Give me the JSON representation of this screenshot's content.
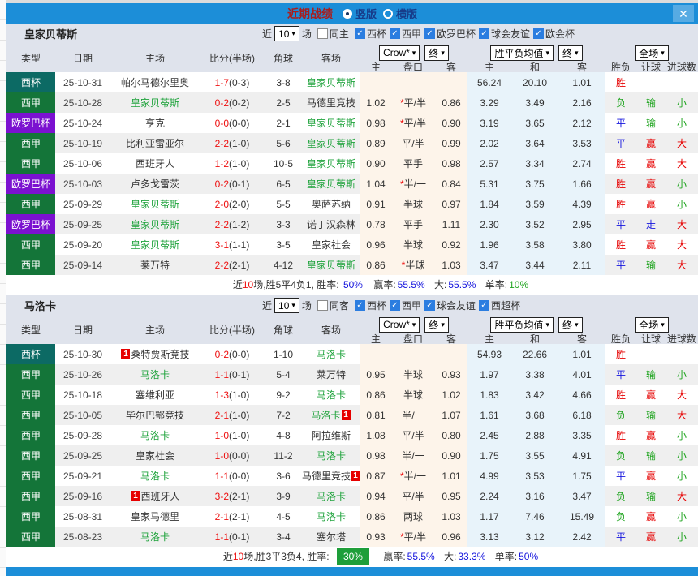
{
  "titlebar": {
    "title": "近期战绩",
    "vertical_label": "竖版",
    "horizontal_label": "横版",
    "close_icon": "✕"
  },
  "icons": {
    "check": "✓",
    "chevron": "▾"
  },
  "controls": {
    "near": "近",
    "count": "10",
    "games": "场",
    "crow": "Crow*",
    "final": "终",
    "avg": "胜平负均值",
    "full": "全场"
  },
  "columns": {
    "type": "类型",
    "date": "日期",
    "home": "主场",
    "score": "比分(半场)",
    "corner": "角球",
    "away": "客场",
    "odd_home": "主",
    "handicap": "盘口",
    "odd_away": "客",
    "avg_home": "主",
    "avg_draw": "和",
    "avg_away": "客",
    "result": "胜负",
    "handicap_result": "让球",
    "goals": "进球数"
  },
  "league_colors": {
    "西杯": "#0c6a64",
    "西甲": "#147539",
    "欧罗巴杯": "#7b11d0"
  },
  "result_colors": {
    "胜": "#e60000",
    "平": "#1414dd",
    "负": "#1fa41f",
    "赢": "#e60000",
    "输": "#1fa41f",
    "走": "#1414dd",
    "大": "#e60000",
    "小": "#1fa41f"
  },
  "colors": {
    "titlebar_blue": "#1c8ed8",
    "header_bg": "#dfe3ec",
    "crow_band": "#fdf4ea",
    "avg_band": "#e8f3fa",
    "win_badge_green": "#1e9e3a"
  },
  "sections": [
    {
      "team": "皇家贝蒂斯",
      "same_label": "同主",
      "leagues": [
        "西杯",
        "西甲",
        "欧罗巴杯",
        "球会友谊",
        "欧会杯"
      ],
      "rows": [
        {
          "league": "西杯",
          "date": "25-10-31",
          "home": "帕尔马德尔里奥",
          "home_green": false,
          "home_card": "",
          "ft": "1-7",
          "ht": "(0-3)",
          "corner": "3-8",
          "away": "皇家贝蒂斯",
          "away_green": true,
          "away_card": "",
          "o1": "",
          "hcap": "",
          "o2": "",
          "a1": "56.24",
          "a2": "20.10",
          "a3": "1.01",
          "res": "胜",
          "let": "",
          "goal": ""
        },
        {
          "league": "西甲",
          "date": "25-10-28",
          "home": "皇家贝蒂斯",
          "home_green": true,
          "home_card": "",
          "ft": "0-2",
          "ht": "(0-2)",
          "corner": "2-5",
          "away": "马德里竞技",
          "away_green": false,
          "away_card": "",
          "o1": "1.02",
          "hcap": "*平/半",
          "o2": "0.86",
          "a1": "3.29",
          "a2": "3.49",
          "a3": "2.16",
          "res": "负",
          "let": "输",
          "goal": "小"
        },
        {
          "league": "欧罗巴杯",
          "date": "25-10-24",
          "home": "亨克",
          "home_green": false,
          "home_card": "",
          "ft": "0-0",
          "ht": "(0-0)",
          "corner": "2-1",
          "away": "皇家贝蒂斯",
          "away_green": true,
          "away_card": "",
          "o1": "0.98",
          "hcap": "*平/半",
          "o2": "0.90",
          "a1": "3.19",
          "a2": "3.65",
          "a3": "2.12",
          "res": "平",
          "let": "输",
          "goal": "小"
        },
        {
          "league": "西甲",
          "date": "25-10-19",
          "home": "比利亚雷亚尔",
          "home_green": false,
          "home_card": "",
          "ft": "2-2",
          "ht": "(1-0)",
          "corner": "5-6",
          "away": "皇家贝蒂斯",
          "away_green": true,
          "away_card": "",
          "o1": "0.89",
          "hcap": "平/半",
          "o2": "0.99",
          "a1": "2.02",
          "a2": "3.64",
          "a3": "3.53",
          "res": "平",
          "let": "赢",
          "goal": "大"
        },
        {
          "league": "西甲",
          "date": "25-10-06",
          "home": "西班牙人",
          "home_green": false,
          "home_card": "",
          "ft": "1-2",
          "ht": "(1-0)",
          "corner": "10-5",
          "away": "皇家贝蒂斯",
          "away_green": true,
          "away_card": "",
          "o1": "0.90",
          "hcap": "平手",
          "o2": "0.98",
          "a1": "2.57",
          "a2": "3.34",
          "a3": "2.74",
          "res": "胜",
          "let": "赢",
          "goal": "大"
        },
        {
          "league": "欧罗巴杯",
          "date": "25-10-03",
          "home": "卢多戈雷茨",
          "home_green": false,
          "home_card": "",
          "ft": "0-2",
          "ht": "(0-1)",
          "corner": "6-5",
          "away": "皇家贝蒂斯",
          "away_green": true,
          "away_card": "",
          "o1": "1.04",
          "hcap": "*半/一",
          "o2": "0.84",
          "a1": "5.31",
          "a2": "3.75",
          "a3": "1.66",
          "res": "胜",
          "let": "赢",
          "goal": "小"
        },
        {
          "league": "西甲",
          "date": "25-09-29",
          "home": "皇家贝蒂斯",
          "home_green": true,
          "home_card": "",
          "ft": "2-0",
          "ht": "(2-0)",
          "corner": "5-5",
          "away": "奥萨苏纳",
          "away_green": false,
          "away_card": "",
          "o1": "0.91",
          "hcap": "半球",
          "o2": "0.97",
          "a1": "1.84",
          "a2": "3.59",
          "a3": "4.39",
          "res": "胜",
          "let": "赢",
          "goal": "小"
        },
        {
          "league": "欧罗巴杯",
          "date": "25-09-25",
          "home": "皇家贝蒂斯",
          "home_green": true,
          "home_card": "",
          "ft": "2-2",
          "ht": "(1-2)",
          "corner": "3-3",
          "away": "诺丁汉森林",
          "away_green": false,
          "away_card": "",
          "o1": "0.78",
          "hcap": "平手",
          "o2": "1.11",
          "a1": "2.30",
          "a2": "3.52",
          "a3": "2.95",
          "res": "平",
          "let": "走",
          "goal": "大"
        },
        {
          "league": "西甲",
          "date": "25-09-20",
          "home": "皇家贝蒂斯",
          "home_green": true,
          "home_card": "",
          "ft": "3-1",
          "ht": "(1-1)",
          "corner": "3-5",
          "away": "皇家社会",
          "away_green": false,
          "away_card": "",
          "o1": "0.96",
          "hcap": "半球",
          "o2": "0.92",
          "a1": "1.96",
          "a2": "3.58",
          "a3": "3.80",
          "res": "胜",
          "let": "赢",
          "goal": "大"
        },
        {
          "league": "西甲",
          "date": "25-09-14",
          "home": "莱万特",
          "home_green": false,
          "home_card": "",
          "ft": "2-2",
          "ht": "(2-1)",
          "corner": "4-12",
          "away": "皇家贝蒂斯",
          "away_green": true,
          "away_card": "",
          "o1": "0.86",
          "hcap": "*半球",
          "o2": "1.03",
          "a1": "3.47",
          "a2": "3.44",
          "a3": "2.11",
          "res": "平",
          "let": "输",
          "goal": "大"
        }
      ],
      "summary": {
        "near_label": "近",
        "count": "10",
        "stats": "场,胜5平4负1, 胜率:",
        "win_rate": "50%",
        "labels": [
          "赢率:",
          "大:",
          "单率:"
        ],
        "values": [
          "55.5%",
          "55.5%",
          "10%"
        ],
        "value_colors": [
          "blue",
          "blue",
          "green"
        ]
      }
    },
    {
      "team": "马洛卡",
      "same_label": "同客",
      "leagues": [
        "西杯",
        "西甲",
        "球会友谊",
        "西超杯"
      ],
      "rows": [
        {
          "league": "西杯",
          "date": "25-10-30",
          "home": "桑特贾斯竞技",
          "home_green": false,
          "home_card": "1",
          "ft": "0-2",
          "ht": "(0-0)",
          "corner": "1-10",
          "away": "马洛卡",
          "away_green": true,
          "away_card": "",
          "o1": "",
          "hcap": "",
          "o2": "",
          "a1": "54.93",
          "a2": "22.66",
          "a3": "1.01",
          "res": "胜",
          "let": "",
          "goal": ""
        },
        {
          "league": "西甲",
          "date": "25-10-26",
          "home": "马洛卡",
          "home_green": true,
          "home_card": "",
          "ft": "1-1",
          "ht": "(0-1)",
          "corner": "5-4",
          "away": "莱万特",
          "away_green": false,
          "away_card": "",
          "o1": "0.95",
          "hcap": "半球",
          "o2": "0.93",
          "a1": "1.97",
          "a2": "3.38",
          "a3": "4.01",
          "res": "平",
          "let": "输",
          "goal": "小"
        },
        {
          "league": "西甲",
          "date": "25-10-18",
          "home": "塞维利亚",
          "home_green": false,
          "home_card": "",
          "ft": "1-3",
          "ht": "(1-0)",
          "corner": "9-2",
          "away": "马洛卡",
          "away_green": true,
          "away_card": "",
          "o1": "0.86",
          "hcap": "半球",
          "o2": "1.02",
          "a1": "1.83",
          "a2": "3.42",
          "a3": "4.66",
          "res": "胜",
          "let": "赢",
          "goal": "大"
        },
        {
          "league": "西甲",
          "date": "25-10-05",
          "home": "毕尔巴鄂竞技",
          "home_green": false,
          "home_card": "",
          "ft": "2-1",
          "ht": "(1-0)",
          "corner": "7-2",
          "away": "马洛卡",
          "away_green": true,
          "away_card": "1",
          "o1": "0.81",
          "hcap": "半/一",
          "o2": "1.07",
          "a1": "1.61",
          "a2": "3.68",
          "a3": "6.18",
          "res": "负",
          "let": "输",
          "goal": "大"
        },
        {
          "league": "西甲",
          "date": "25-09-28",
          "home": "马洛卡",
          "home_green": true,
          "home_card": "",
          "ft": "1-0",
          "ht": "(1-0)",
          "corner": "4-8",
          "away": "阿拉维斯",
          "away_green": false,
          "away_card": "",
          "o1": "1.08",
          "hcap": "平/半",
          "o2": "0.80",
          "a1": "2.45",
          "a2": "2.88",
          "a3": "3.35",
          "res": "胜",
          "let": "赢",
          "goal": "小"
        },
        {
          "league": "西甲",
          "date": "25-09-25",
          "home": "皇家社会",
          "home_green": false,
          "home_card": "",
          "ft": "1-0",
          "ht": "(0-0)",
          "corner": "11-2",
          "away": "马洛卡",
          "away_green": true,
          "away_card": "",
          "o1": "0.98",
          "hcap": "半/一",
          "o2": "0.90",
          "a1": "1.75",
          "a2": "3.55",
          "a3": "4.91",
          "res": "负",
          "let": "输",
          "goal": "小"
        },
        {
          "league": "西甲",
          "date": "25-09-21",
          "home": "马洛卡",
          "home_green": true,
          "home_card": "",
          "ft": "1-1",
          "ht": "(0-0)",
          "corner": "3-6",
          "away": "马德里竞技",
          "away_green": false,
          "away_card": "1",
          "o1": "0.87",
          "hcap": "*半/一",
          "o2": "1.01",
          "a1": "4.99",
          "a2": "3.53",
          "a3": "1.75",
          "res": "平",
          "let": "赢",
          "goal": "小"
        },
        {
          "league": "西甲",
          "date": "25-09-16",
          "home": "西班牙人",
          "home_green": false,
          "home_card": "1",
          "ft": "3-2",
          "ht": "(2-1)",
          "corner": "3-9",
          "away": "马洛卡",
          "away_green": true,
          "away_card": "",
          "o1": "0.94",
          "hcap": "平/半",
          "o2": "0.95",
          "a1": "2.24",
          "a2": "3.16",
          "a3": "3.47",
          "res": "负",
          "let": "输",
          "goal": "大"
        },
        {
          "league": "西甲",
          "date": "25-08-31",
          "home": "皇家马德里",
          "home_green": false,
          "home_card": "",
          "ft": "2-1",
          "ht": "(2-1)",
          "corner": "4-5",
          "away": "马洛卡",
          "away_green": true,
          "away_card": "",
          "o1": "0.86",
          "hcap": "两球",
          "o2": "1.03",
          "a1": "1.17",
          "a2": "7.46",
          "a3": "15.49",
          "res": "负",
          "let": "赢",
          "goal": "小"
        },
        {
          "league": "西甲",
          "date": "25-08-23",
          "home": "马洛卡",
          "home_green": true,
          "home_card": "",
          "ft": "1-1",
          "ht": "(0-1)",
          "corner": "3-4",
          "away": "塞尔塔",
          "away_green": false,
          "away_card": "",
          "o1": "0.93",
          "hcap": "*平/半",
          "o2": "0.96",
          "a1": "3.13",
          "a2": "3.12",
          "a3": "2.42",
          "res": "平",
          "let": "赢",
          "goal": "小"
        }
      ],
      "summary": {
        "near_label": "近",
        "count": "10",
        "stats": "场,胜3平3负4, 胜率:",
        "win_rate": "30%",
        "labels": [
          "赢率:",
          "大:",
          "单率:"
        ],
        "values": [
          "55.5%",
          "33.3%",
          "50%"
        ],
        "value_colors": [
          "blue",
          "blue",
          "blue"
        ]
      }
    }
  ]
}
